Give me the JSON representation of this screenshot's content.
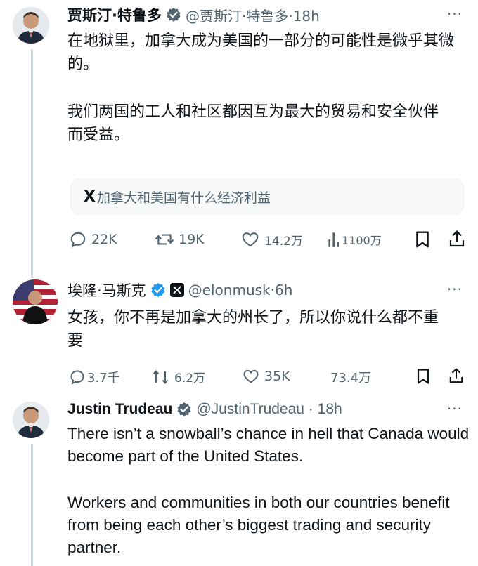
{
  "tweets": [
    {
      "author": "贾斯汀·特鲁多",
      "handle": "@贾斯汀·特鲁多·18h",
      "more": "···",
      "paragraphs": [
        "在地狱里，加拿大成为美国的一部分的可能性是微乎其微的。",
        "我们两国的工人和社区都因互为最大的贸易和安全伙伴而受益。"
      ],
      "related_search": {
        "logo": "X",
        "text": "加拿大和美国有什么经济利益"
      },
      "actions": {
        "replies": "22K",
        "reposts": "19K",
        "likes": "14.2万",
        "views": "1100万"
      }
    },
    {
      "author": "埃隆·马斯克",
      "handle": "@elonmusk·6h",
      "more": "···",
      "paragraphs": [
        "女孩，你不再是加拿大的州长了，所以你说什么都不重要"
      ],
      "actions": {
        "replies": "3.7千",
        "reposts": "6.2万",
        "likes": "35K",
        "views": "73.4万"
      }
    },
    {
      "author": "Justin Trudeau",
      "handle": "@JustinTrudeau · 18h",
      "more": "···",
      "paragraphs": [
        "There isn’t a snowball’s chance in hell that Canada would become part of the United States.",
        "Workers and communities in both our countries benefit from being each other’s biggest trading and security partner."
      ]
    }
  ],
  "colors": {
    "text": "#0f1419",
    "secondary": "#536471",
    "verified_blue": "#1d9bf0",
    "divider": "#cfd9de"
  },
  "icons": [
    "reply-icon",
    "repost-icon",
    "like-icon",
    "views-icon",
    "bookmark-icon",
    "share-icon",
    "verified-icon",
    "more-icon"
  ]
}
